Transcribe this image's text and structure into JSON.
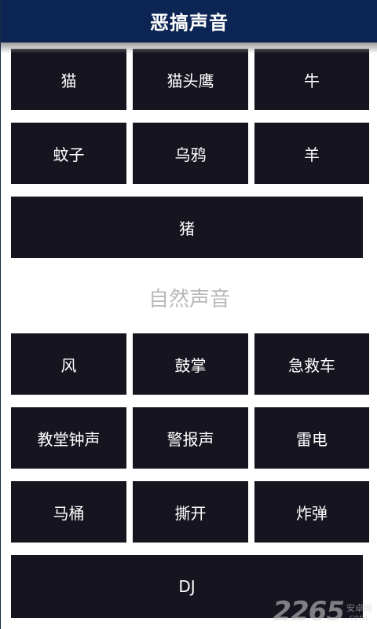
{
  "header": {
    "title": "恶搞声音"
  },
  "section_animals": {
    "buttons": [
      "猫",
      "猫头鹰",
      "牛",
      "蚊子",
      "乌鸦",
      "羊",
      "猪"
    ]
  },
  "section_nature": {
    "title": "自然声音",
    "buttons": [
      "风",
      "鼓掌",
      "急救车",
      "教堂钟声",
      "警报声",
      "雷电",
      "马桶",
      "撕开",
      "炸弹",
      "DJ"
    ]
  },
  "watermark": {
    "number": "2265",
    "site_line1": "安卓网",
    "site_line2": ".com"
  },
  "colors": {
    "header_bg": "#0c2554",
    "button_bg": "#15141f",
    "section_text": "#b8b8b8"
  }
}
